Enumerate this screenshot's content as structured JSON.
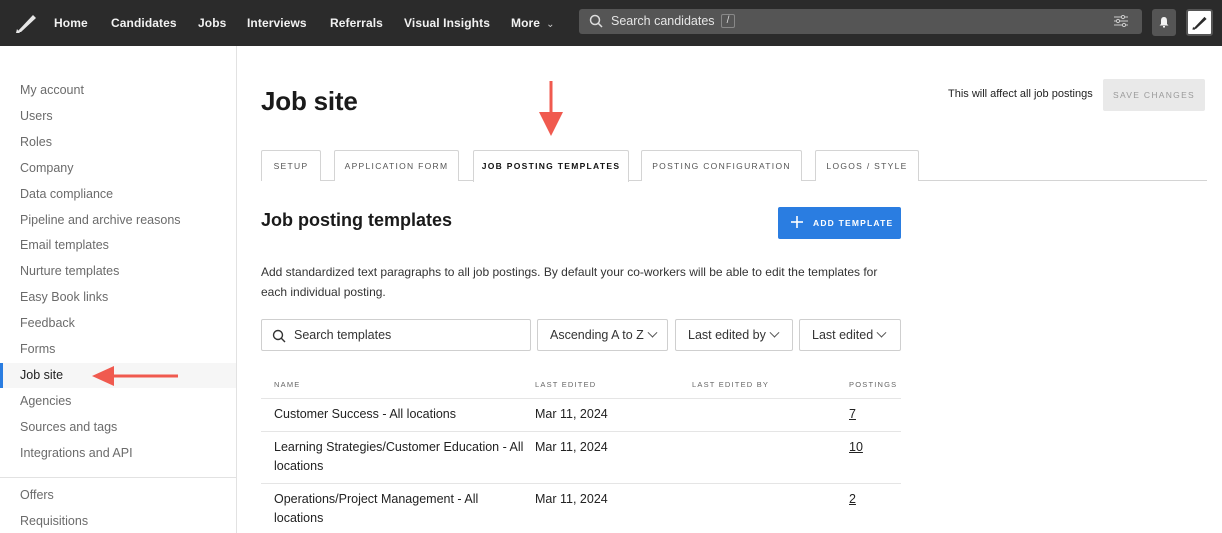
{
  "nav": {
    "items": [
      "Home",
      "Candidates",
      "Jobs",
      "Interviews",
      "Referrals",
      "Visual Insights",
      "More"
    ],
    "search_placeholder": "Search candidates",
    "search_shortcut": "/"
  },
  "sidebar": {
    "items": [
      "My account",
      "Users",
      "Roles",
      "Company",
      "Data compliance",
      "Pipeline and archive reasons",
      "Email templates",
      "Nurture templates",
      "Easy Book links",
      "Feedback",
      "Forms",
      "Job site",
      "Agencies",
      "Sources and tags",
      "Integrations and API"
    ],
    "active": "Job site",
    "secondary_items": [
      "Offers",
      "Requisitions"
    ]
  },
  "header": {
    "title": "Job site",
    "note": "This will affect all job postings",
    "save_label": "SAVE CHANGES"
  },
  "tabs": [
    "SETUP",
    "APPLICATION FORM",
    "JOB POSTING TEMPLATES",
    "POSTING CONFIGURATION",
    "LOGOS / STYLE"
  ],
  "active_tab": "JOB POSTING TEMPLATES",
  "section": {
    "title": "Job posting templates",
    "add_label": "ADD TEMPLATE",
    "description": "Add standardized text paragraphs to all job postings. By default your co-workers will be able to edit the templates for each individual posting."
  },
  "filters": {
    "search_placeholder": "Search templates",
    "sort": "Ascending A to Z",
    "edited_by": "Last edited by",
    "edited": "Last edited"
  },
  "table": {
    "headers": [
      "NAME",
      "LAST EDITED",
      "LAST EDITED BY",
      "POSTINGS"
    ],
    "rows": [
      {
        "name": "Customer Success - All locations",
        "last_edited": "Mar 11, 2024",
        "last_edited_by": "",
        "postings": "7"
      },
      {
        "name": "Learning Strategies/Customer Education - All locations",
        "last_edited": "Mar 11, 2024",
        "last_edited_by": "",
        "postings": "10"
      },
      {
        "name": "Operations/Project Management - All locations",
        "last_edited": "Mar 11, 2024",
        "last_edited_by": "",
        "postings": "2"
      }
    ]
  },
  "colors": {
    "topbar": "#2b2b2b",
    "accent": "#2a7de1",
    "annotation_arrow": "#f05a4f"
  }
}
